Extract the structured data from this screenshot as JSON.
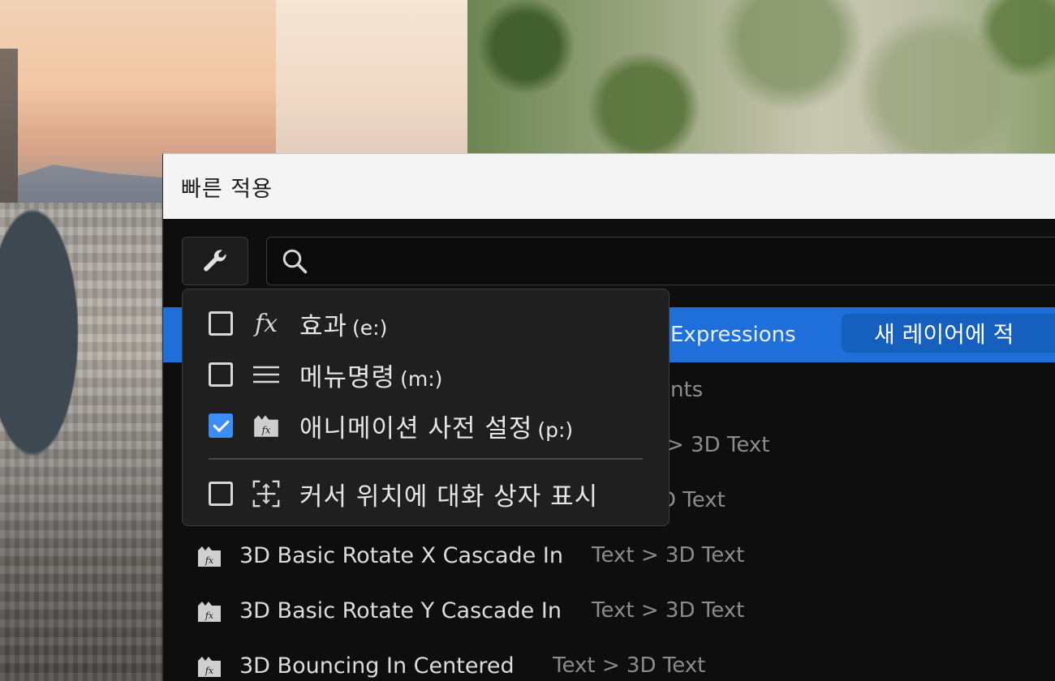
{
  "dialog": {
    "title": "빠른 적용"
  },
  "search": {
    "value": "",
    "placeholder": ""
  },
  "filter_menu": {
    "items": [
      {
        "label": "효과",
        "shortcut": "(e:)",
        "checked": false,
        "icon": "fx-icon"
      },
      {
        "label": "메뉴명령",
        "shortcut": "(m:)",
        "checked": false,
        "icon": "menu-lines-icon"
      },
      {
        "label": "애니메이션 사전 설정",
        "shortcut": "(p:)",
        "checked": true,
        "icon": "preset-icon"
      }
    ],
    "option": {
      "label": "커서 위치에 대화 상자 표시",
      "checked": false,
      "icon": "cursor-position-icon"
    }
  },
  "results": [
    {
      "name": "",
      "category": "Expressions",
      "selected": true
    },
    {
      "name": "",
      "category": "nts",
      "selected": false
    },
    {
      "name": "",
      "category": "> 3D Text",
      "selected": false
    },
    {
      "name": "",
      "category": "D Text",
      "selected": false
    },
    {
      "name": "3D Basic Rotate X Cascade In",
      "category": "Text > 3D Text",
      "selected": false
    },
    {
      "name": "3D Basic Rotate Y Cascade In",
      "category": "Text > 3D Text",
      "selected": false
    },
    {
      "name": "3D Bouncing In Centered",
      "category": "Text > 3D Text",
      "selected": false
    }
  ],
  "apply_button": {
    "label": "새 레이어에 적"
  },
  "colors": {
    "selection": "#1e6fd9",
    "apply_button": "#155fbf",
    "checkbox_checked": "#3a8ef6",
    "dialog_bg": "#0e0e0e",
    "titlebar_bg": "#f4f4f4"
  }
}
